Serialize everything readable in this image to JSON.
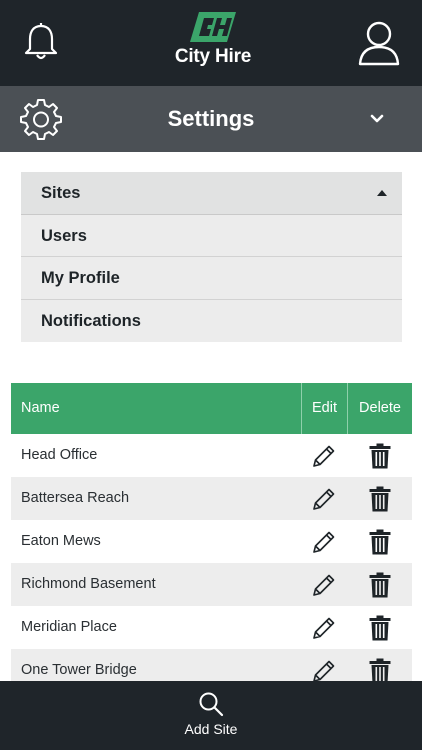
{
  "header": {
    "brand_name": "City Hire",
    "notifications_icon": "bell-icon",
    "profile_icon": "user-icon",
    "brand_color": "#3ba56a"
  },
  "settings_bar": {
    "title": "Settings",
    "icon": "gear-icon",
    "expand_icon": "chevron-down-icon"
  },
  "settings_menu": {
    "items": [
      {
        "label": "Sites",
        "selected": true
      },
      {
        "label": "Users"
      },
      {
        "label": "My Profile"
      },
      {
        "label": "Notifications"
      }
    ]
  },
  "sites_table": {
    "columns": {
      "name": "Name",
      "edit": "Edit",
      "delete": "Delete"
    },
    "rows": [
      {
        "name": "Head Office"
      },
      {
        "name": "Battersea Reach"
      },
      {
        "name": "Eaton Mews"
      },
      {
        "name": "Richmond Basement"
      },
      {
        "name": "Meridian Place"
      },
      {
        "name": "One Tower Bridge"
      }
    ],
    "edit_icon": "pencil-icon",
    "delete_icon": "trash-icon"
  },
  "footer": {
    "add_site_label": "Add Site",
    "add_site_icon": "search-icon"
  }
}
